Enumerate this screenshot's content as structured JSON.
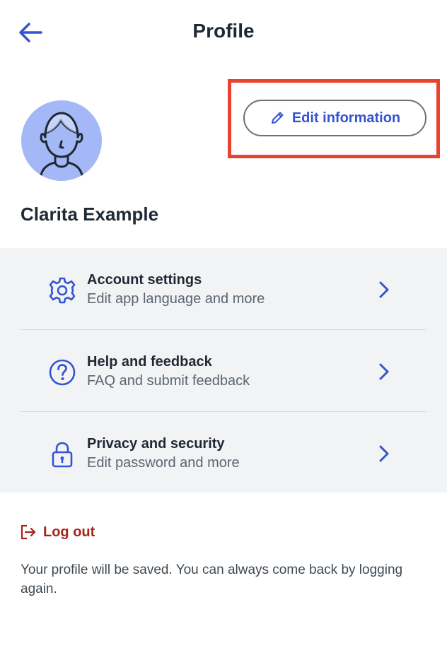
{
  "header": {
    "title": "Profile",
    "back_icon": "arrow-left-icon"
  },
  "colors": {
    "accent": "#3454d1",
    "danger": "#a5241a",
    "avatar_bg": "#a4b8f7",
    "highlight": "#e8432e",
    "section_bg": "#f2f3f5"
  },
  "profile": {
    "name": "Clarita Example",
    "avatar_icon": "person-avatar-icon",
    "edit_button": {
      "label": "Edit information",
      "icon": "pencil-icon"
    }
  },
  "menu": {
    "items": [
      {
        "title": "Account settings",
        "subtitle": "Edit app language and more",
        "icon": "gear-icon"
      },
      {
        "title": "Help and feedback",
        "subtitle": "FAQ and submit feedback",
        "icon": "question-circle-icon"
      },
      {
        "title": "Privacy and security",
        "subtitle": "Edit password and more",
        "icon": "lock-icon"
      }
    ]
  },
  "logout": {
    "label": "Log out",
    "icon": "logout-icon"
  },
  "footer": {
    "note": "Your profile will be saved. You can always come back by logging again."
  }
}
